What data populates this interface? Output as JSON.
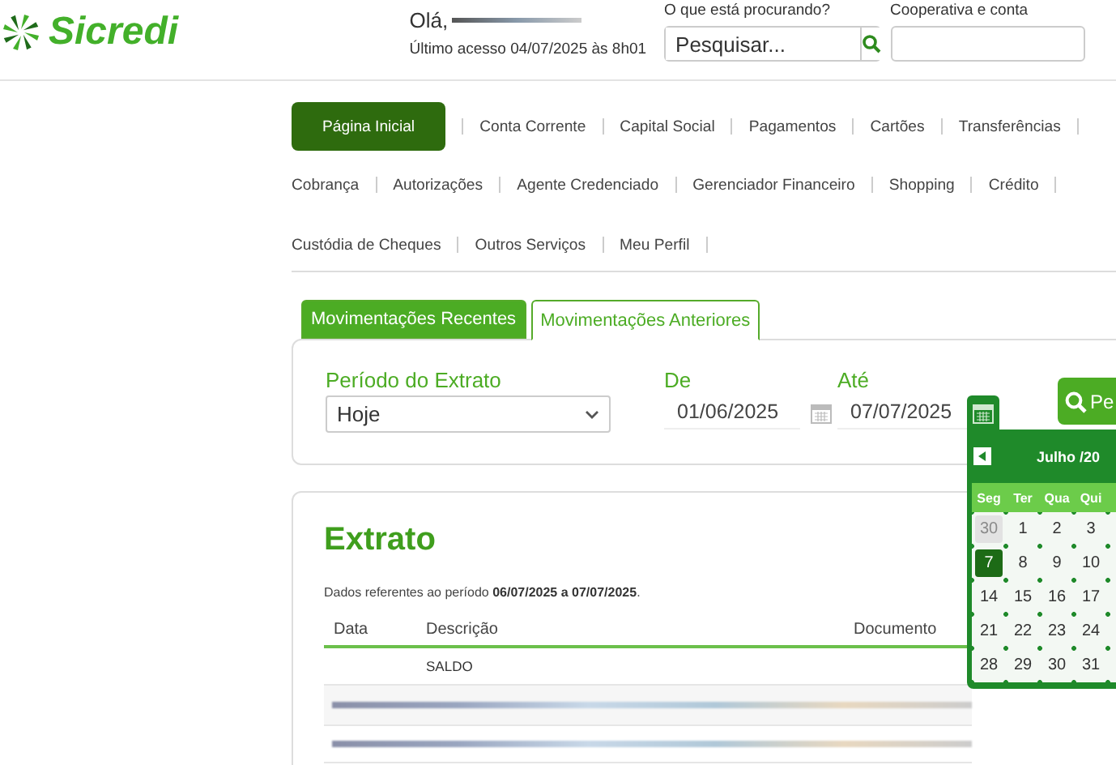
{
  "header": {
    "logo_text": "Sicredi",
    "greeting": "Olá,",
    "last_access": "Último acesso 04/07/2025 às 8h01",
    "search": {
      "label": "O que está procurando?",
      "placeholder": "Pesquisar..."
    },
    "account": {
      "label": "Cooperativa e conta"
    }
  },
  "nav": [
    [
      {
        "label": "Página Inicial",
        "selected": true
      },
      {
        "label": "Conta Corrente",
        "selected": false
      },
      {
        "label": "Capital Social",
        "selected": false
      },
      {
        "label": "Pagamentos",
        "selected": false
      },
      {
        "label": "Cartões",
        "selected": false
      },
      {
        "label": "Transferências",
        "selected": false
      }
    ],
    [
      {
        "label": "Cobrança",
        "selected": false
      },
      {
        "label": "Autorizações",
        "selected": false
      },
      {
        "label": "Agente Credenciado",
        "selected": false
      },
      {
        "label": "Gerenciador Financeiro",
        "selected": false
      },
      {
        "label": "Shopping",
        "selected": false
      },
      {
        "label": "Crédito",
        "selected": false
      }
    ],
    [
      {
        "label": "Custódia de Cheques",
        "selected": false
      },
      {
        "label": "Outros Serviços",
        "selected": false
      },
      {
        "label": "Meu Perfil",
        "selected": false
      }
    ]
  ],
  "tabs": [
    {
      "label": "Movimentações Recentes",
      "selected": false
    },
    {
      "label": "Movimentações Anteriores",
      "selected": true
    }
  ],
  "filter": {
    "period_label": "Período do Extrato",
    "period_value": "Hoje",
    "from_label": "De",
    "from_value": "01/06/2025",
    "to_label": "Até",
    "to_value": "07/07/2025",
    "search_button": "Pe"
  },
  "calendar": {
    "month": "Julho /20",
    "weekdays": [
      "Seg",
      "Ter",
      "Qua",
      "Qui"
    ],
    "days": [
      {
        "label": "30",
        "selected": false,
        "other_month": true
      },
      {
        "label": "1",
        "selected": false,
        "other_month": false
      },
      {
        "label": "2",
        "selected": false,
        "other_month": false
      },
      {
        "label": "3",
        "selected": false,
        "other_month": false
      },
      {
        "label": "7",
        "selected": true,
        "other_month": false
      },
      {
        "label": "8",
        "selected": false,
        "other_month": false
      },
      {
        "label": "9",
        "selected": false,
        "other_month": false
      },
      {
        "label": "10",
        "selected": false,
        "other_month": false
      },
      {
        "label": "14",
        "selected": false,
        "other_month": false
      },
      {
        "label": "15",
        "selected": false,
        "other_month": false
      },
      {
        "label": "16",
        "selected": false,
        "other_month": false
      },
      {
        "label": "17",
        "selected": false,
        "other_month": false
      },
      {
        "label": "21",
        "selected": false,
        "other_month": false
      },
      {
        "label": "22",
        "selected": false,
        "other_month": false
      },
      {
        "label": "23",
        "selected": false,
        "other_month": false
      },
      {
        "label": "24",
        "selected": false,
        "other_month": false
      },
      {
        "label": "28",
        "selected": false,
        "other_month": false
      },
      {
        "label": "29",
        "selected": false,
        "other_month": false
      },
      {
        "label": "30",
        "selected": false,
        "other_month": false
      },
      {
        "label": "31",
        "selected": false,
        "other_month": false
      }
    ]
  },
  "statement": {
    "title": "Extrato",
    "period_text": "Dados referentes ao período **06/07/2025 a 07/07/2025**.",
    "columns": [
      "Data",
      "Descrição",
      "Documento"
    ],
    "rows": [
      {
        "kind": "text",
        "cells": [
          "",
          "SALDO",
          ""
        ]
      },
      {
        "kind": "redacted"
      },
      {
        "kind": "redacted"
      }
    ]
  }
}
